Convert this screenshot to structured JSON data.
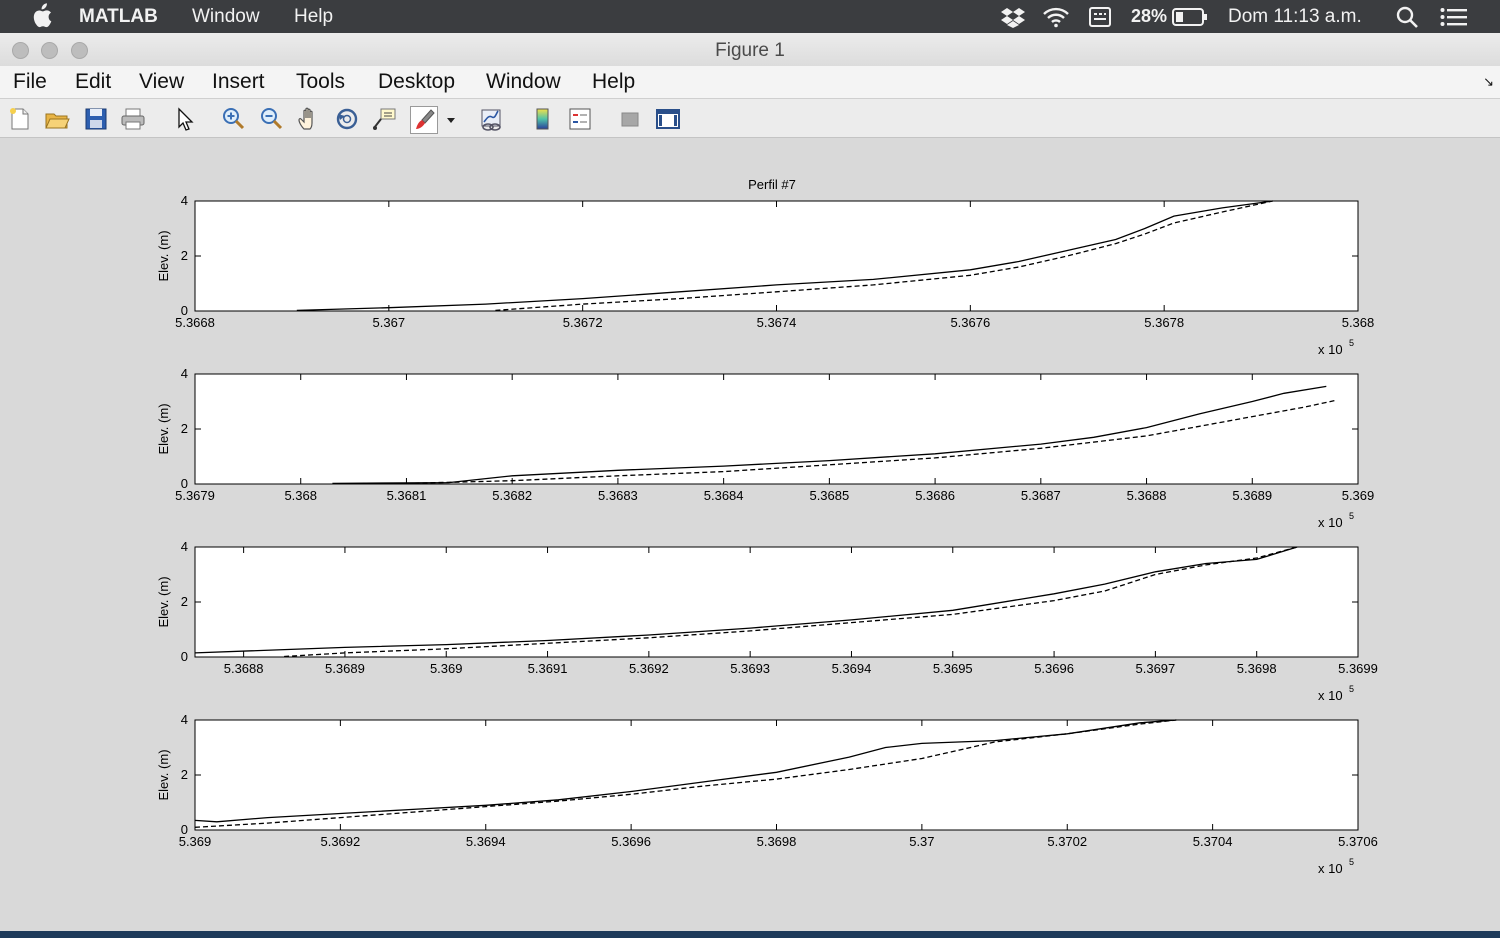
{
  "system_menubar": {
    "app_name": "MATLAB",
    "menus": [
      "Window",
      "Help"
    ],
    "battery": "28%",
    "clock": "Dom 11:13 a.m."
  },
  "window": {
    "title": "Figure 1"
  },
  "menu": [
    "File",
    "Edit",
    "View",
    "Insert",
    "Tools",
    "Desktop",
    "Window",
    "Help"
  ],
  "toolbar": [
    "new-figure-icon",
    "open-file-icon",
    "save-icon",
    "print-icon",
    "select-arrow-icon",
    "zoom-in-icon",
    "zoom-out-icon",
    "pan-hand-icon",
    "rotate-3d-icon",
    "data-cursor-icon",
    "brush-icon",
    "dropdown-caret-icon",
    "link-plot-icon",
    "colorbar-icon",
    "legend-icon",
    "hide-plot-tools-icon",
    "show-plot-tools-icon"
  ],
  "figure": {
    "title": "Perfil #7"
  },
  "chart_data": [
    {
      "type": "line",
      "title": "Perfil #7",
      "ylabel": "Elev. (m)",
      "xlim": [
        536680,
        536800
      ],
      "ylim": [
        0,
        4
      ],
      "yticks": [
        "0",
        "2",
        "4"
      ],
      "xticks": [
        536680,
        536700,
        536720,
        536740,
        536760,
        536780,
        536800
      ],
      "xtick_labels": [
        "5.3668",
        "5.367",
        "5.3672",
        "5.3674",
        "5.3676",
        "5.3678",
        "5.368"
      ],
      "exponent": "x 10^5",
      "series": [
        {
          "style": "solid",
          "x": [
            536690.5,
            536700,
            536710,
            536720,
            536730,
            536740,
            536750,
            536760,
            536765,
            536770,
            536775,
            536778,
            536781,
            536786,
            536791.2
          ],
          "values": [
            0.02,
            0.12,
            0.25,
            0.45,
            0.7,
            0.95,
            1.15,
            1.5,
            1.8,
            2.2,
            2.6,
            3.0,
            3.45,
            3.75,
            4.0
          ]
        },
        {
          "style": "dashed",
          "x": [
            536711,
            536720,
            536730,
            536740,
            536750,
            536760,
            536765,
            536770,
            536775,
            536778,
            536781,
            536786,
            536791.2
          ],
          "values": [
            0.02,
            0.25,
            0.45,
            0.7,
            0.95,
            1.3,
            1.6,
            2.0,
            2.45,
            2.8,
            3.2,
            3.6,
            4.0
          ]
        }
      ]
    },
    {
      "type": "line",
      "ylabel": "Elev. (m)",
      "xlim": [
        536790,
        536900
      ],
      "ylim": [
        0,
        4
      ],
      "yticks": [
        "0",
        "2",
        "4"
      ],
      "xticks": [
        536790,
        536800,
        536810,
        536820,
        536830,
        536840,
        536850,
        536860,
        536870,
        536880,
        536890,
        536900
      ],
      "xtick_labels": [
        "5.3679",
        "5.368",
        "5.3681",
        "5.3682",
        "5.3683",
        "5.3684",
        "5.3685",
        "5.3686",
        "5.3687",
        "5.3688",
        "5.3689",
        "5.369"
      ],
      "exponent": "x 10^5",
      "series": [
        {
          "style": "solid",
          "x": [
            536803,
            536814,
            536820,
            536830,
            536840,
            536850,
            536860,
            536870,
            536875,
            536880,
            536885,
            536890,
            536893,
            536897
          ],
          "values": [
            0.02,
            0.05,
            0.3,
            0.5,
            0.65,
            0.85,
            1.1,
            1.45,
            1.7,
            2.05,
            2.55,
            3.0,
            3.3,
            3.55
          ]
        },
        {
          "style": "dashed",
          "x": [
            536810,
            536820,
            536830,
            536840,
            536850,
            536860,
            536870,
            536880,
            536885,
            536890,
            536895,
            536898
          ],
          "values": [
            0.02,
            0.12,
            0.3,
            0.45,
            0.7,
            0.95,
            1.3,
            1.75,
            2.1,
            2.45,
            2.8,
            3.05
          ]
        }
      ]
    },
    {
      "type": "line",
      "ylabel": "Elev. (m)",
      "xlim": [
        536875.2,
        536990
      ],
      "ylim": [
        0,
        4
      ],
      "yticks": [
        "0",
        "2",
        "4"
      ],
      "xticks": [
        536880,
        536890,
        536900,
        536910,
        536920,
        536930,
        536940,
        536950,
        536960,
        536970,
        536980,
        536990
      ],
      "xtick_labels": [
        "5.3688",
        "5.3689",
        "5.369",
        "5.3691",
        "5.3692",
        "5.3693",
        "5.3694",
        "5.3695",
        "5.3696",
        "5.3697",
        "5.3698",
        "5.3699"
      ],
      "exponent": "x 10^5",
      "series": [
        {
          "style": "solid",
          "x": [
            536875.2,
            536890,
            536900,
            536910,
            536920,
            536930,
            536940,
            536950,
            536960,
            536965,
            536970,
            536975,
            536980,
            536984
          ],
          "values": [
            0.15,
            0.35,
            0.45,
            0.6,
            0.8,
            1.05,
            1.35,
            1.7,
            2.3,
            2.65,
            3.1,
            3.4,
            3.55,
            4.0
          ]
        },
        {
          "style": "dashed",
          "x": [
            536884,
            536890,
            536900,
            536910,
            536920,
            536930,
            536940,
            536950,
            536960,
            536965,
            536970,
            536975,
            536980,
            536984
          ],
          "values": [
            0.02,
            0.15,
            0.3,
            0.5,
            0.7,
            0.95,
            1.25,
            1.55,
            2.05,
            2.4,
            3.0,
            3.35,
            3.6,
            4.0
          ]
        }
      ]
    },
    {
      "type": "line",
      "ylabel": "Elev. (m)",
      "xlim": [
        536900,
        537060
      ],
      "ylim": [
        0,
        4
      ],
      "yticks": [
        "0",
        "2",
        "4"
      ],
      "xticks": [
        536900,
        536920,
        536940,
        536960,
        536980,
        537000,
        537020,
        537040,
        537060
      ],
      "xtick_labels": [
        "5.369",
        "5.3692",
        "5.3694",
        "5.3696",
        "5.3698",
        "5.37",
        "5.3702",
        "5.3704",
        "5.3706"
      ],
      "exponent": "x 10^5",
      "series": [
        {
          "style": "solid",
          "x": [
            536900,
            536903,
            536910,
            536920,
            536930,
            536940,
            536950,
            536960,
            536970,
            536980,
            536990,
            536995,
            537000,
            537010,
            537020,
            537030,
            537035
          ],
          "values": [
            0.35,
            0.3,
            0.45,
            0.6,
            0.75,
            0.9,
            1.1,
            1.4,
            1.75,
            2.1,
            2.65,
            3.0,
            3.15,
            3.25,
            3.5,
            3.9,
            4.0
          ]
        },
        {
          "style": "dashed",
          "x": [
            536900,
            536910,
            536920,
            536930,
            536940,
            536950,
            536960,
            536970,
            536980,
            536990,
            537000,
            537005,
            537010,
            537020,
            537030,
            537035
          ],
          "values": [
            0.1,
            0.25,
            0.45,
            0.65,
            0.85,
            1.05,
            1.3,
            1.6,
            1.85,
            2.2,
            2.6,
            2.9,
            3.2,
            3.5,
            3.85,
            4.0
          ]
        }
      ]
    }
  ]
}
